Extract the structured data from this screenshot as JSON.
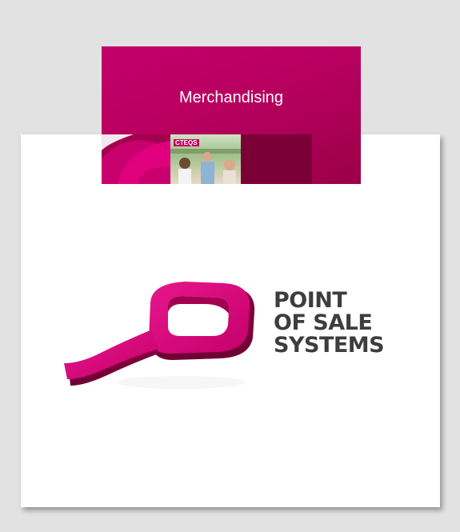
{
  "banner": {
    "title": "Merchandising",
    "photo_sign": "CTEQS"
  },
  "logo": {
    "lines": [
      "POINT",
      "OF SALE",
      "SYSTEMS"
    ],
    "icon": "magnifier-p-logo-icon"
  },
  "colors": {
    "background": "#e2e2e2",
    "card": "#ffffff",
    "brand_magenta": "#c2006b",
    "text_dark": "#3d3d3d"
  }
}
